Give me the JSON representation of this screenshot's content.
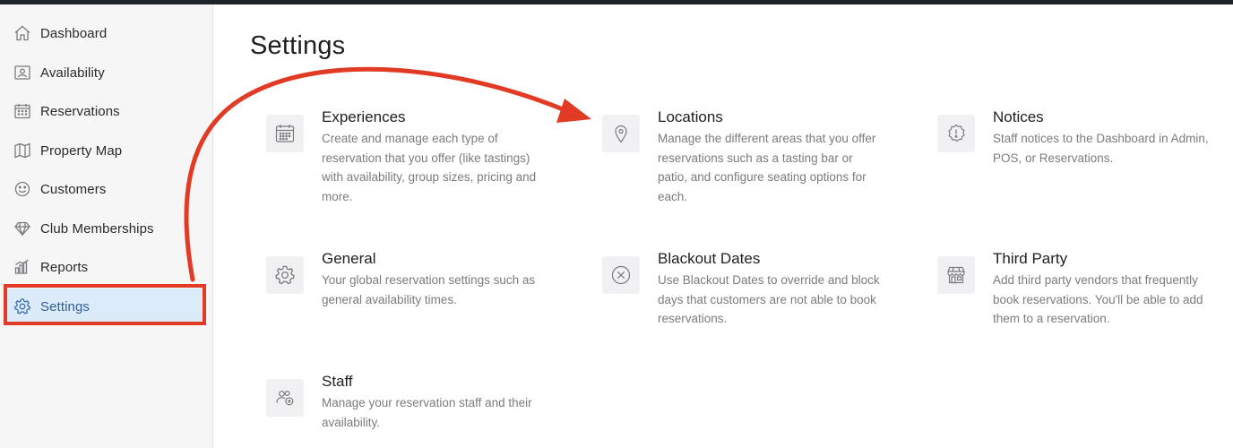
{
  "sidebar": {
    "items": [
      {
        "label": "Dashboard",
        "icon": "home-icon"
      },
      {
        "label": "Availability",
        "icon": "availability-icon"
      },
      {
        "label": "Reservations",
        "icon": "calendar-icon"
      },
      {
        "label": "Property Map",
        "icon": "map-icon"
      },
      {
        "label": "Customers",
        "icon": "smiley-icon"
      },
      {
        "label": "Club Memberships",
        "icon": "diamond-icon"
      },
      {
        "label": "Reports",
        "icon": "bar-chart-icon"
      },
      {
        "label": "Settings",
        "icon": "gear-icon",
        "active": true
      }
    ]
  },
  "main": {
    "title": "Settings",
    "cards": [
      {
        "title": "Experiences",
        "description": "Create and manage each type of reservation that you offer (like tastings) with availability, group sizes, pricing and more.",
        "icon": "calendar-icon"
      },
      {
        "title": "Locations",
        "description": "Manage the different areas that you offer reservations such as a tasting bar or patio, and configure seating options for each.",
        "icon": "map-pin-icon"
      },
      {
        "title": "Notices",
        "description": "Staff notices to the Dashboard in Admin, POS, or Reservations.",
        "icon": "alert-badge-icon"
      },
      {
        "title": "General",
        "description": "Your global reservation settings such as general availability times.",
        "icon": "gear-icon"
      },
      {
        "title": "Blackout Dates",
        "description": "Use Blackout Dates to override and block days that customers are not able to book reservations.",
        "icon": "x-circle-icon"
      },
      {
        "title": "Third Party",
        "description": "Add third party vendors that frequently book reservations. You'll be able to add them to a reservation.",
        "icon": "storefront-icon"
      },
      {
        "title": "Staff",
        "description": "Manage your reservation staff and their availability.",
        "icon": "staff-add-icon"
      }
    ]
  },
  "annotation": {
    "color": "#e23b25"
  }
}
